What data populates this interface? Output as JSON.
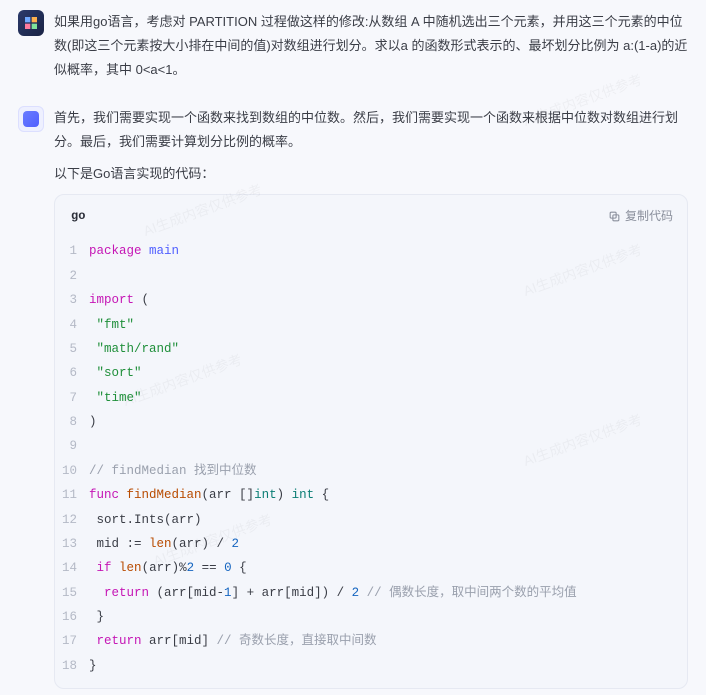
{
  "user_message": "如果用go语言，考虑对 PARTITION 过程做这样的修改:从数组 A 中随机选出三个元素，并用这三个元素的中位数(即这三个元素按大小排在中间的值)对数组进行划分。求以a 的函数形式表示的、最坏划分比例为 a:(1-a)的近似概率，其中 0<a<1。",
  "ai_message": {
    "para1": "首先，我们需要实现一个函数来找到数组的中位数。然后，我们需要实现一个函数来根据中位数对数组进行划分。最后，我们需要计算划分比例的概率。",
    "para2": "以下是Go语言实现的代码："
  },
  "code_block": {
    "lang": "go",
    "copy_label": "复制代码",
    "lines": [
      {
        "n": 1,
        "html": "<span class='tok-kw'>package</span> <span class='tok-pkg'>main</span>"
      },
      {
        "n": 2,
        "html": ""
      },
      {
        "n": 3,
        "html": "<span class='tok-kw'>import</span> ("
      },
      {
        "n": 4,
        "html": " <span class='tok-str'>\"fmt\"</span>"
      },
      {
        "n": 5,
        "html": " <span class='tok-str'>\"math/rand\"</span>"
      },
      {
        "n": 6,
        "html": " <span class='tok-str'>\"sort\"</span>"
      },
      {
        "n": 7,
        "html": " <span class='tok-str'>\"time\"</span>"
      },
      {
        "n": 8,
        "html": ")"
      },
      {
        "n": 9,
        "html": ""
      },
      {
        "n": 10,
        "html": "<span class='tok-cmt'>// findMedian 找到中位数</span>"
      },
      {
        "n": 11,
        "html": "<span class='tok-kw'>func</span> <span class='tok-fn'>findMedian</span>(arr []<span class='tok-type'>int</span>) <span class='tok-type'>int</span> {"
      },
      {
        "n": 12,
        "html": " sort.Ints(arr)"
      },
      {
        "n": 13,
        "html": " mid := <span class='tok-fn'>len</span>(arr) / <span class='tok-num'>2</span>"
      },
      {
        "n": 14,
        "html": " <span class='tok-kw'>if</span> <span class='tok-fn'>len</span>(arr)%<span class='tok-num'>2</span> == <span class='tok-num'>0</span> {"
      },
      {
        "n": 15,
        "html": "  <span class='tok-kw'>return</span> (arr[mid-<span class='tok-num'>1</span>] + arr[mid]) / <span class='tok-num'>2</span> <span class='tok-cmt'>// 偶数长度，取中间两个数的平均值</span>"
      },
      {
        "n": 16,
        "html": " }"
      },
      {
        "n": 17,
        "html": " <span class='tok-kw'>return</span> arr[mid] <span class='tok-cmt'>// 奇数长度，直接取中间数</span>"
      },
      {
        "n": 18,
        "html": "}"
      }
    ]
  },
  "watermark_text": "AI生成内容仅供参考"
}
